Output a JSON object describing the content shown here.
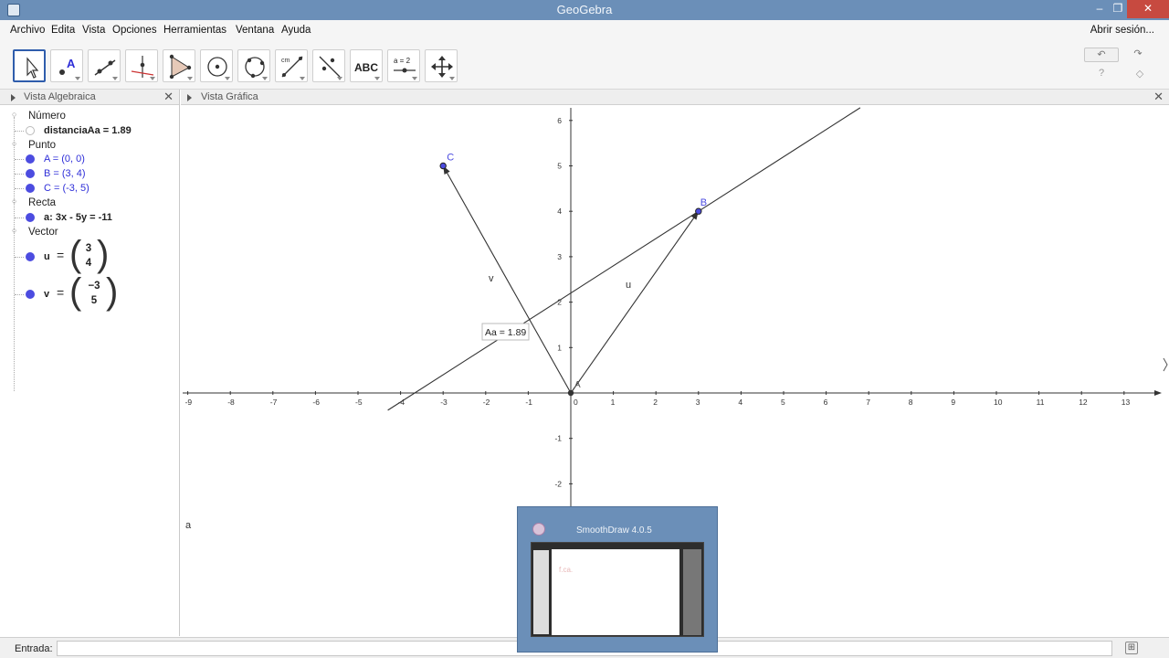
{
  "window": {
    "title": "GeoGebra"
  },
  "menu": {
    "items": [
      "Archivo",
      "Edita",
      "Vista",
      "Opciones",
      "Herramientas",
      "Ventana",
      "Ayuda"
    ],
    "login": "Abrir sesión..."
  },
  "toolbar": {
    "tools": [
      "move-tool",
      "point-tool",
      "line-tool",
      "perpendicular-line-tool",
      "polygon-tool",
      "circle-center-point-tool",
      "circle-three-points-tool",
      "angle-tool",
      "reflect-tool",
      "text-tool",
      "slider-tool",
      "move-graphics-view-tool"
    ],
    "text_tool_label": "ABC",
    "slider_tool_label": "a = 2",
    "help_label": "?"
  },
  "algebra": {
    "header": "Vista Algebraica",
    "groups": [
      {
        "title": "Número",
        "items": [
          "distanciaAa = 1.89"
        ]
      },
      {
        "title": "Punto",
        "items": [
          "A = (0, 0)",
          "B = (3, 4)",
          "C = (-3, 5)"
        ]
      },
      {
        "title": "Recta",
        "items": [
          "a: 3x - 5y = -11"
        ]
      },
      {
        "title": "Vector",
        "vectors": [
          {
            "name": "u",
            "x": "3",
            "y": "4"
          },
          {
            "name": "v",
            "x": "−3",
            "y": "5"
          }
        ]
      }
    ]
  },
  "graphics": {
    "header": "Vista Gráfica",
    "x_ticks": [
      "-9",
      "-8",
      "-7",
      "-6",
      "-5",
      "-4",
      "-3",
      "-2",
      "-1",
      "0",
      "1",
      "2",
      "3",
      "4",
      "5",
      "6",
      "7",
      "8",
      "9",
      "10",
      "11",
      "12",
      "13"
    ],
    "y_ticks": [
      "6",
      "5",
      "4",
      "3",
      "2",
      "1",
      "0",
      "-1",
      "-2"
    ],
    "labels": {
      "A": "A",
      "B": "B",
      "C": "C",
      "u": "u",
      "v": "v",
      "a": "a"
    },
    "distance_label": "Aa = 1.89",
    "colors": {
      "point": "#4c4ce0",
      "axes": "#333333",
      "line": "#333333"
    }
  },
  "input_bar": {
    "label": "Entrada:"
  },
  "thumbnail": {
    "title": "SmoothDraw 4.0.5",
    "canvas_text": "f.ca."
  }
}
